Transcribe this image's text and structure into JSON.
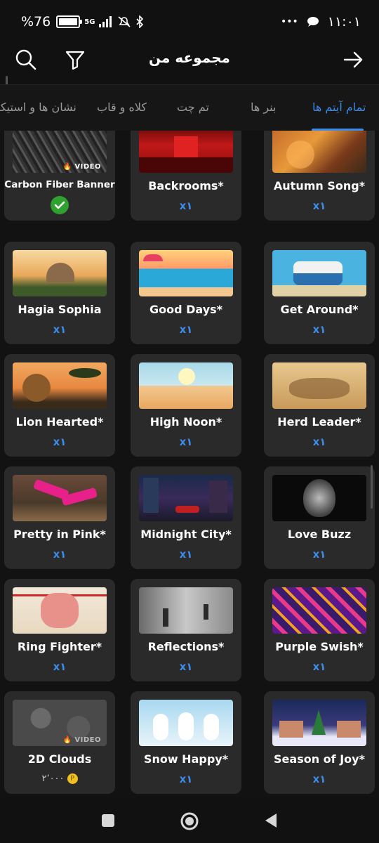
{
  "status_bar": {
    "battery": "%76",
    "network": "5G",
    "time": "۱۱:۰۱",
    "more": "•••"
  },
  "header": {
    "title": "مجموعه من"
  },
  "tabs": [
    {
      "label": "تمام آیتم ها",
      "active": true
    },
    {
      "label": "بنر ها",
      "active": false
    },
    {
      "label": "تم چت",
      "active": false
    },
    {
      "label": "کلاه و قاب",
      "active": false
    },
    {
      "label": "نشان ها و استیکر",
      "active": false
    }
  ],
  "items": [
    {
      "name": "Autumn Song*",
      "qty": "x۱"
    },
    {
      "name": "Backrooms*",
      "qty": "x۱"
    },
    {
      "name": "Carbon Fiber Banner",
      "badge": "VIDEO",
      "owned": true
    },
    {
      "name": "Get Around*",
      "qty": "x۱"
    },
    {
      "name": "Good Days*",
      "qty": "x۱"
    },
    {
      "name": "Hagia Sophia",
      "qty": "x۱"
    },
    {
      "name": "Herd Leader*",
      "qty": "x۱"
    },
    {
      "name": "High Noon*",
      "qty": "x۱"
    },
    {
      "name": "Lion Hearted*",
      "qty": "x۱"
    },
    {
      "name": "Love Buzz",
      "qty": "x۱"
    },
    {
      "name": "Midnight City*",
      "qty": "x۱"
    },
    {
      "name": "Pretty in Pink*",
      "qty": "x۱"
    },
    {
      "name": "Purple Swish*",
      "qty": "x۱"
    },
    {
      "name": "Reflections*",
      "qty": "x۱"
    },
    {
      "name": "Ring Fighter*",
      "qty": "x۱"
    },
    {
      "name": "Season of Joy*",
      "qty": "x۱"
    },
    {
      "name": "Snow Happy*",
      "qty": "x۱"
    },
    {
      "name": "2D Clouds",
      "badge": "VIDEO",
      "price": "۲٬۰۰۰"
    }
  ],
  "colors": {
    "accent": "#3c8be6",
    "card": "#2a2a2a",
    "background": "#111111",
    "owned_check": "#2fa12f",
    "coin": "#f0c020"
  }
}
